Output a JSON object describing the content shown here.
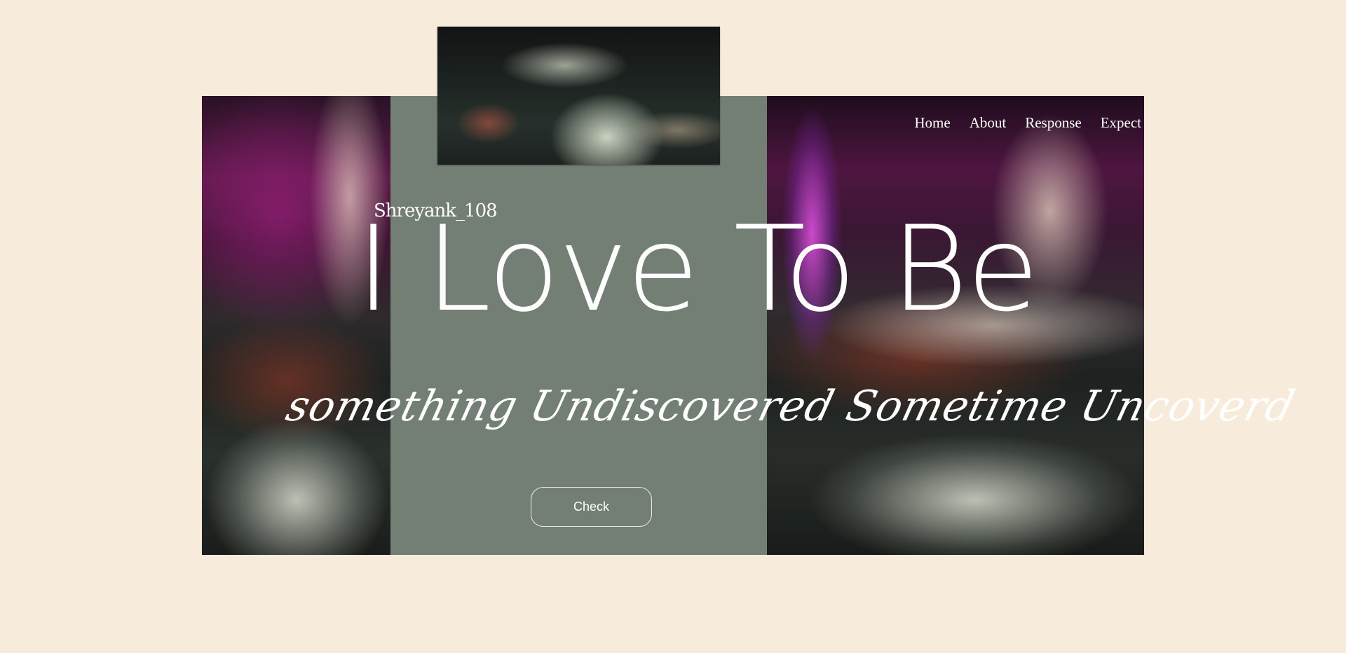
{
  "brand": {
    "name": "Shreyank_108"
  },
  "nav": {
    "items": [
      {
        "label": "Home"
      },
      {
        "label": "About"
      },
      {
        "label": "Response"
      },
      {
        "label": "Expect"
      }
    ]
  },
  "hero": {
    "headline": "I Love To Be",
    "tagline": "something Undiscovered Sometime Uncoverd",
    "cta_label": "Check"
  },
  "colors": {
    "page_background": "#f7ecdc",
    "center_panel": "#737f74",
    "text": "#ffffff"
  }
}
